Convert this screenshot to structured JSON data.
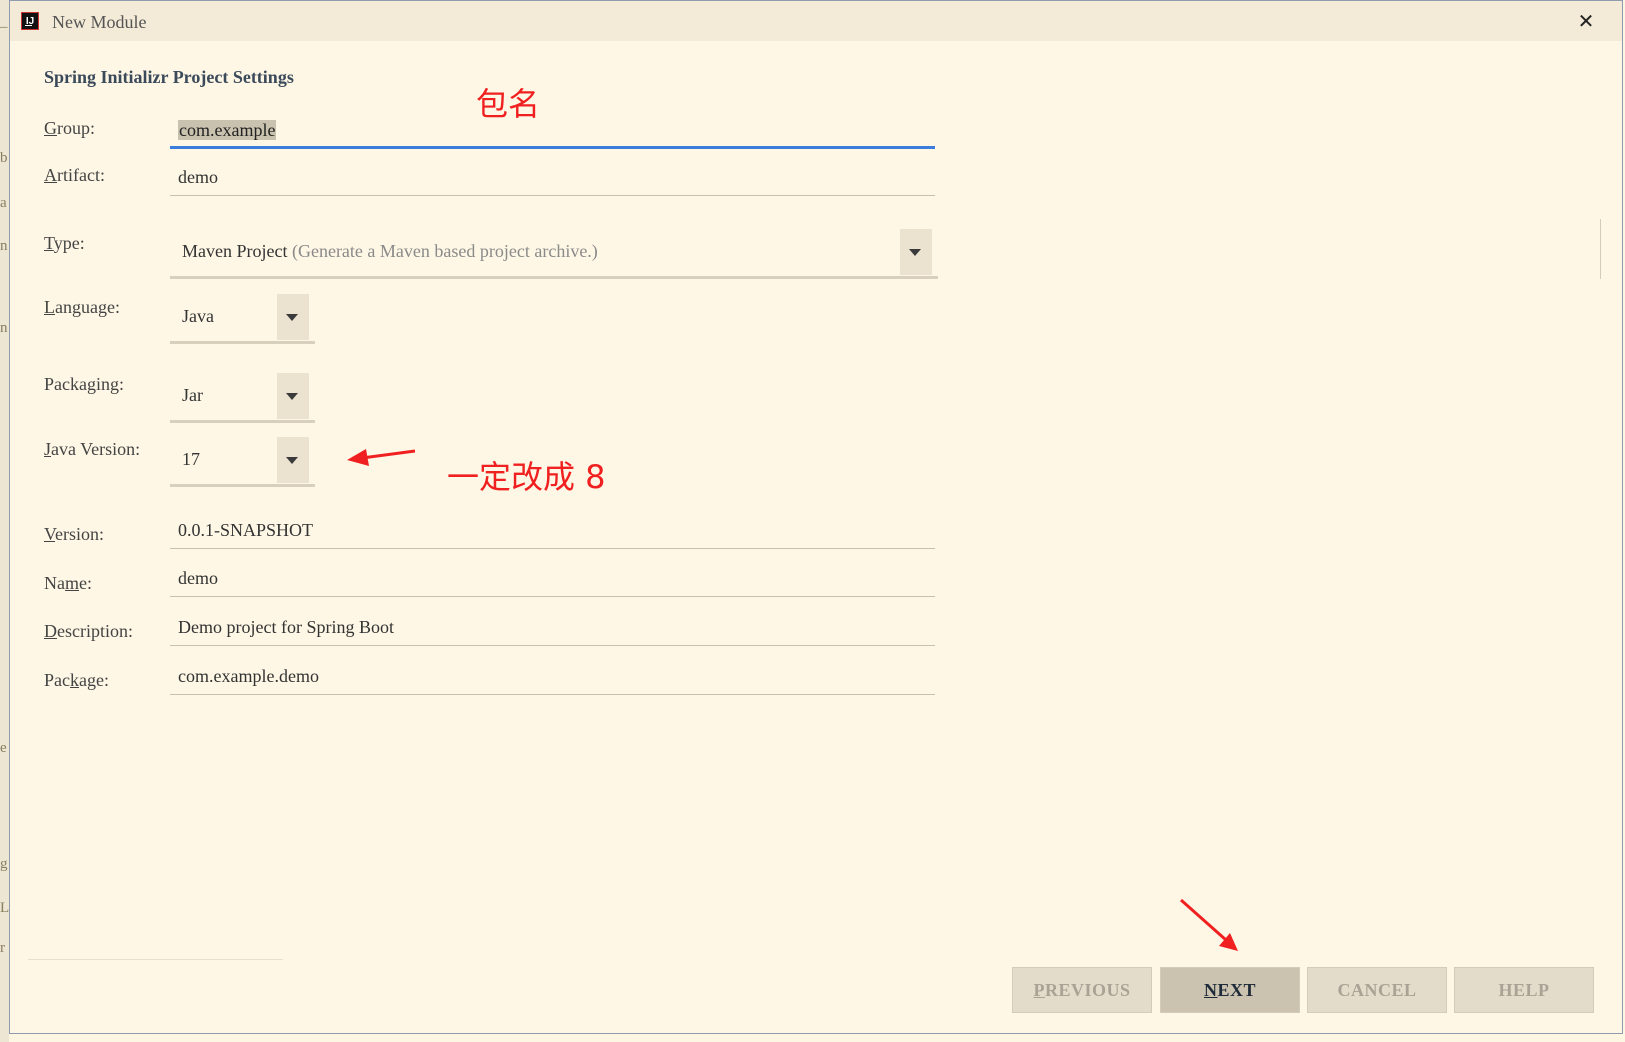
{
  "window": {
    "title": "New Module"
  },
  "section_title": "Spring Initializr Project Settings",
  "fields": {
    "group": {
      "label_mnemonic": "G",
      "label_rest": "roup:",
      "value": "com.example"
    },
    "artifact": {
      "label_mnemonic": "A",
      "label_rest": "rtifact:",
      "value": "demo"
    },
    "type": {
      "label_mnemonic": "T",
      "label_rest": "ype:",
      "value": "Maven Project",
      "hint": "(Generate a Maven based project archive.)"
    },
    "language": {
      "label_mnemonic": "L",
      "label_rest": "anguage:",
      "value": "Java"
    },
    "packaging": {
      "label_pre": "Packa",
      "label_mnemonic": "g",
      "label_rest": "ing:",
      "value": "Jar"
    },
    "java_version": {
      "label_mnemonic": "J",
      "label_rest": "ava Version:",
      "value": "17"
    },
    "version": {
      "label_mnemonic": "V",
      "label_rest": "ersion:",
      "value": "0.0.1-SNAPSHOT"
    },
    "name": {
      "label_pre": "Na",
      "label_mnemonic": "m",
      "label_rest": "e:",
      "value": "demo"
    },
    "description": {
      "label_mnemonic": "D",
      "label_rest": "escription:",
      "value": "Demo project for Spring Boot"
    },
    "package": {
      "label_pre": "Pac",
      "label_mnemonic": "k",
      "label_rest": "age:",
      "value": "com.example.demo"
    }
  },
  "annotations": {
    "package_name": "包名",
    "must_change": "一定改成 8",
    "color": "#f02020"
  },
  "buttons": {
    "previous": {
      "mnemonic": "P",
      "rest": "REVIOUS"
    },
    "next": {
      "mnemonic": "N",
      "rest": "EXT"
    },
    "cancel": {
      "label": "CANCEL"
    },
    "help": {
      "label": "HELP"
    }
  },
  "theme": {
    "focus_color": "#3b7ddd",
    "background": "#fef7e5"
  }
}
